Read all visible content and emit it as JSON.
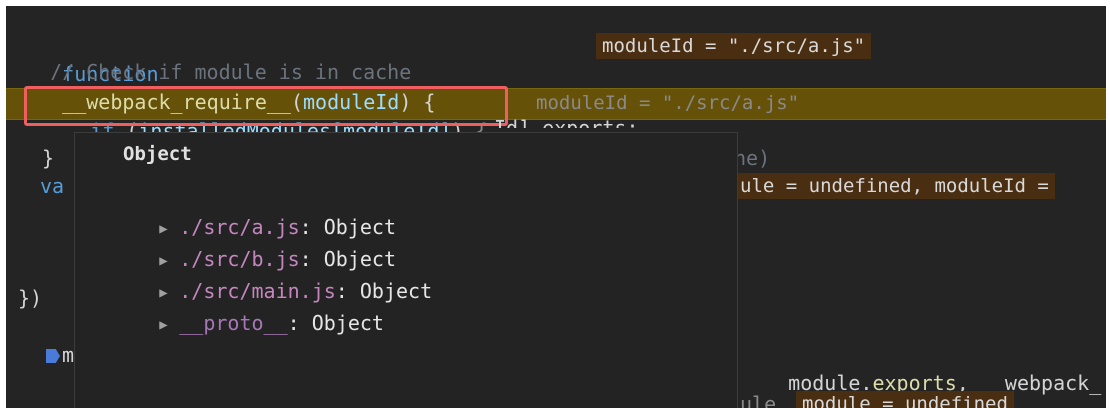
{
  "code": {
    "line1": {
      "keyword": "function",
      "name": "__webpack_require__",
      "open": "(",
      "param": "moduleId",
      "close": ") {",
      "inline_value": "moduleId = \"./src/a.js\""
    },
    "line2": {
      "comment": "// Check if module is in cache"
    },
    "line3": {
      "keyword": "if",
      "open": "(",
      "expr": "installedModules[moduleId]",
      "close": ")",
      "brace": "{",
      "inline_value": "moduleId = \"./src/a.js\""
    },
    "line4": {
      "text": "Id].exports;"
    },
    "line5": {
      "brace": "}",
      "partial": "he)"
    },
    "line6": {
      "prefix": "va",
      "inline_value": "ule = undefined, moduleId ="
    },
    "line7": {
      "text": "})"
    },
    "line8": {
      "prefix": "m",
      "text": "module.",
      "prop": "exports",
      "rest": ", __webpack_"
    },
    "line9": {
      "text": "ule",
      "inline_value": "module = undefined"
    }
  },
  "tooltip": {
    "title": "Object",
    "items": [
      {
        "key": "./src/a.js",
        "sep": ": ",
        "value": "Object"
      },
      {
        "key": "./src/b.js",
        "sep": ": ",
        "value": "Object"
      },
      {
        "key": "./src/main.js",
        "sep": ": ",
        "value": "Object"
      },
      {
        "key": "__proto__",
        "sep": ": ",
        "value": "Object"
      }
    ]
  },
  "icons": {
    "expand": "▶"
  }
}
